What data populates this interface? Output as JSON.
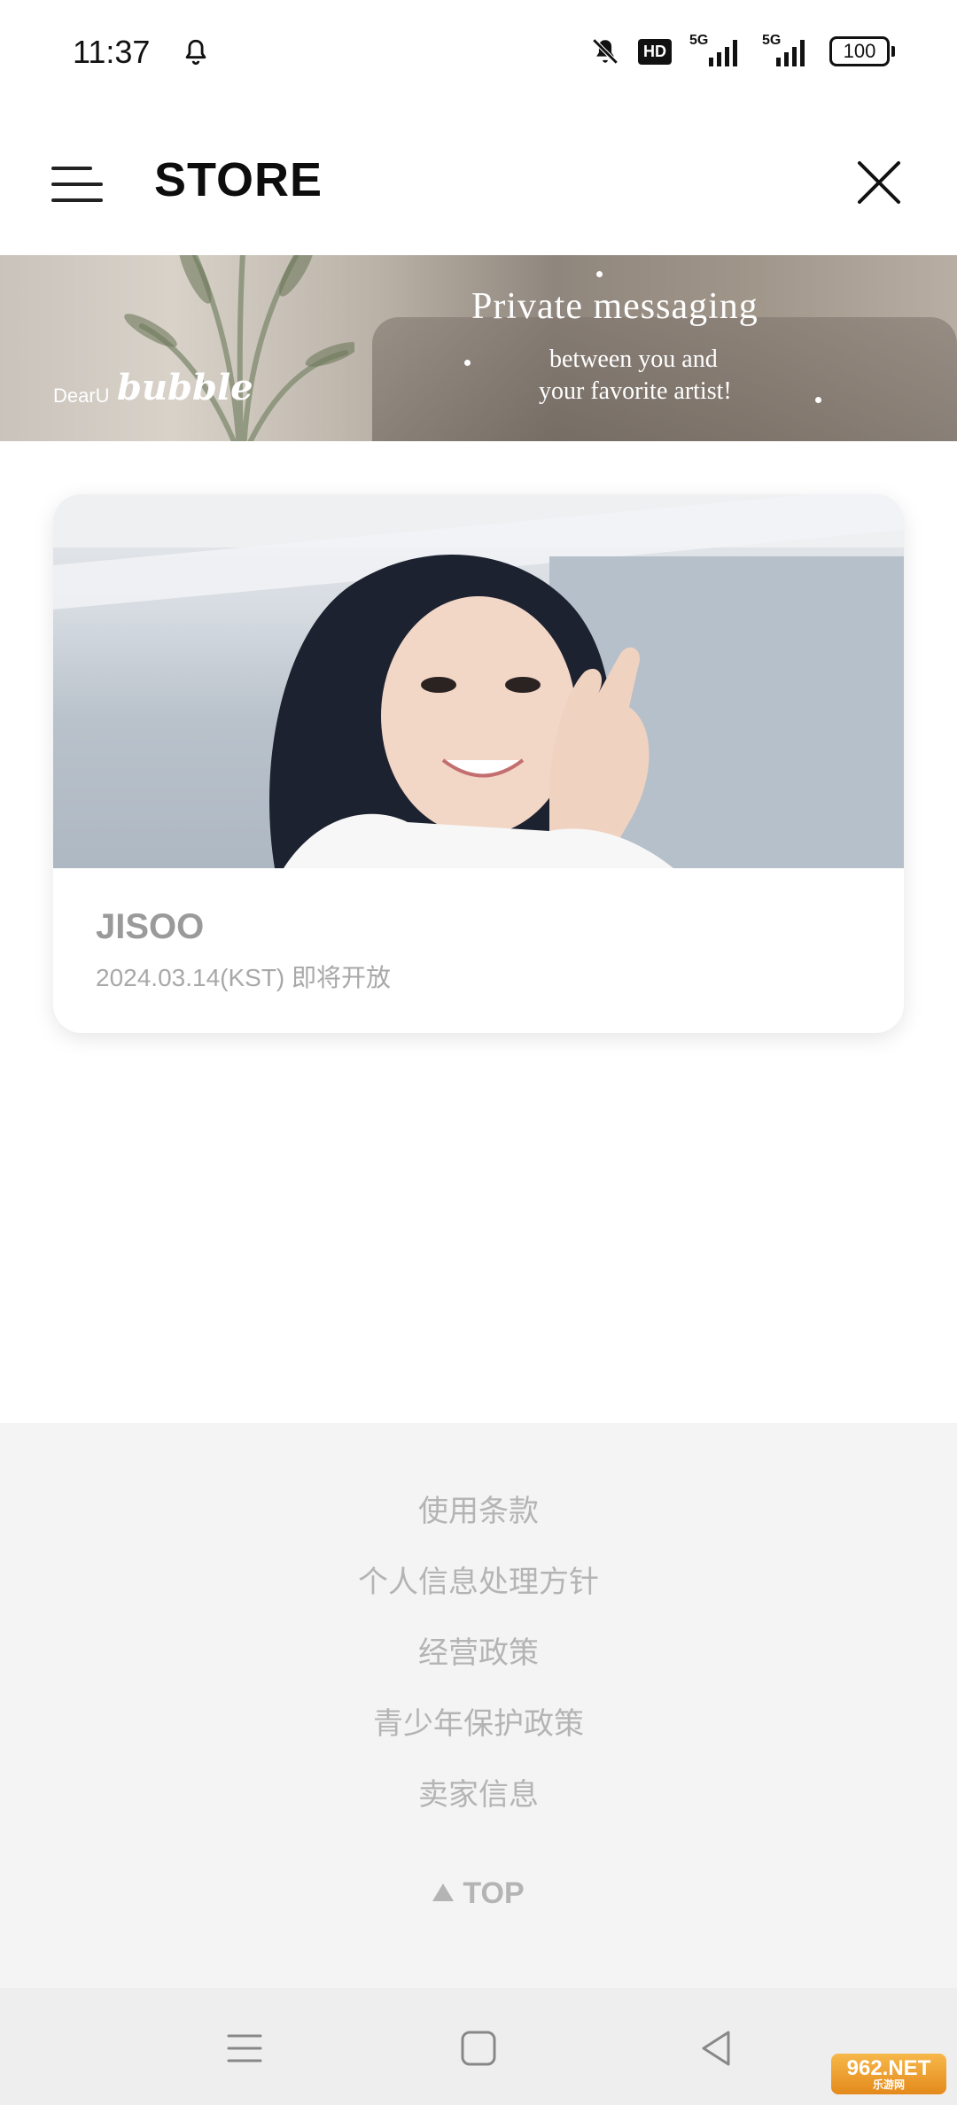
{
  "status_bar": {
    "time": "11:37",
    "hd_badge": "HD",
    "network1": "5G",
    "network2": "5G",
    "battery": "100"
  },
  "header": {
    "title": "STORE"
  },
  "banner": {
    "brand_small": "DearU",
    "brand_big": "bubble",
    "headline": "Private messaging",
    "subline1": "between you and",
    "subline2": "your favorite artist!"
  },
  "artist_card": {
    "name": "JISOO",
    "date": "2024.03.14(KST) 即将开放"
  },
  "footer": {
    "links": [
      "使用条款",
      "个人信息处理方针",
      "经营政策",
      "青少年保护政策",
      "卖家信息"
    ],
    "top_label": "TOP"
  },
  "watermark": {
    "big": "962.NET",
    "small": "乐游网"
  },
  "colors": {
    "accent": "#0d0d0d",
    "muted_text": "#b4b4b4",
    "footer_bg": "#f4f4f4"
  }
}
